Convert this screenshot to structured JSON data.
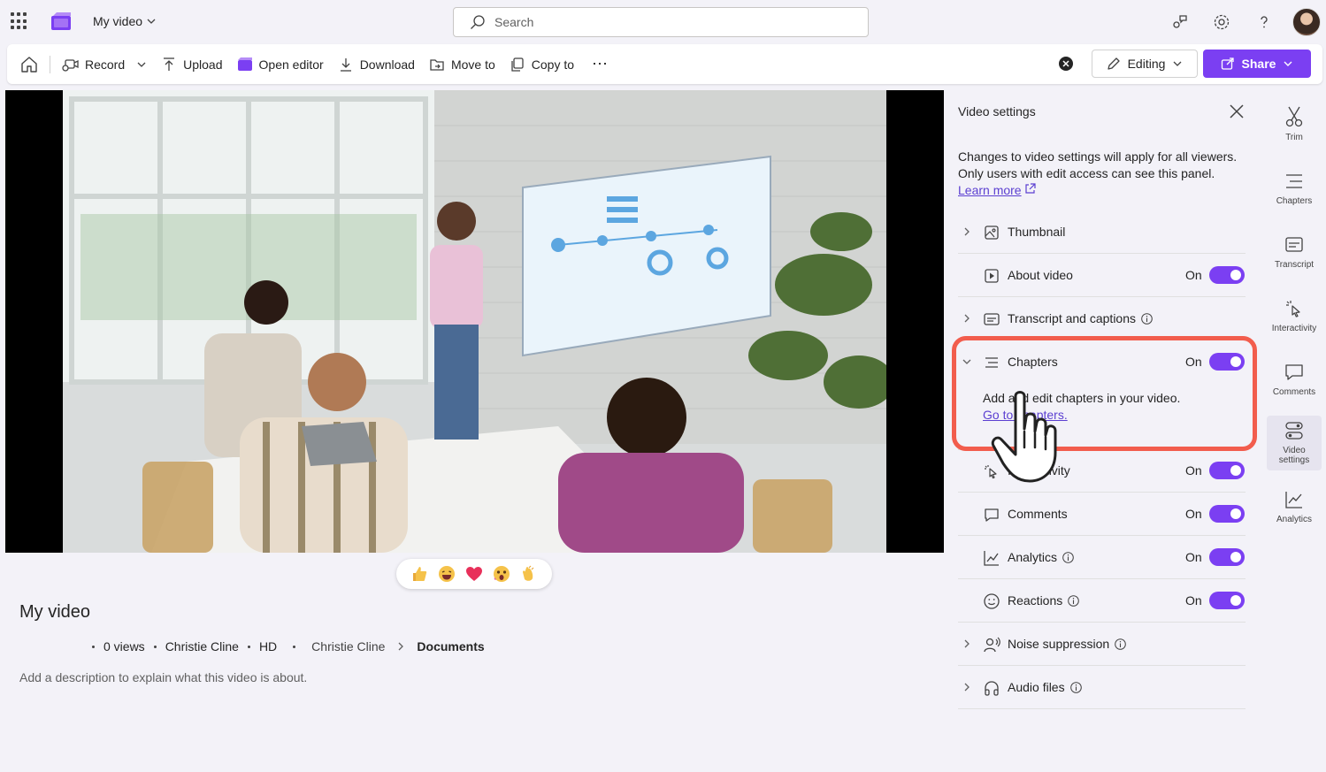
{
  "app": {
    "title": "My video"
  },
  "search": {
    "placeholder": "Search"
  },
  "toolbar": {
    "record": "Record",
    "upload": "Upload",
    "open_editor": "Open editor",
    "download": "Download",
    "move_to": "Move to",
    "copy_to": "Copy to",
    "more": "⋯",
    "editing": "Editing",
    "share": "Share"
  },
  "video": {
    "title": "My video",
    "meta": {
      "views": "0 views",
      "owner": "Christie Cline",
      "quality": "HD",
      "location_owner": "Christie Cline",
      "location_folder": "Documents"
    },
    "description_placeholder": "Add a description to explain what this video is about."
  },
  "panel": {
    "title": "Video settings",
    "description": "Changes to video settings will apply for all viewers. Only users with edit access can see this panel.",
    "learn_more": "Learn more",
    "on_label": "On",
    "rows": [
      {
        "label": "Thumbnail"
      },
      {
        "label": "About video"
      },
      {
        "label": "Transcript and captions"
      },
      {
        "label": "Chapters"
      },
      {
        "label": "Interactivity"
      },
      {
        "label": "Comments"
      },
      {
        "label": "Analytics"
      },
      {
        "label": "Reactions"
      },
      {
        "label": "Noise suppression"
      },
      {
        "label": "Audio files"
      }
    ],
    "chapters_description": "Add and edit chapters in your video.",
    "chapters_link": "Go to chapters."
  },
  "rail": [
    {
      "label": "Trim"
    },
    {
      "label": "Chapters"
    },
    {
      "label": "Transcript"
    },
    {
      "label": "Interactivity"
    },
    {
      "label": "Comments"
    },
    {
      "label": "Video settings"
    },
    {
      "label": "Analytics"
    }
  ],
  "colors": {
    "accent": "#7b3ff2",
    "highlight": "#f25d4d",
    "link": "#5b3fd1"
  }
}
